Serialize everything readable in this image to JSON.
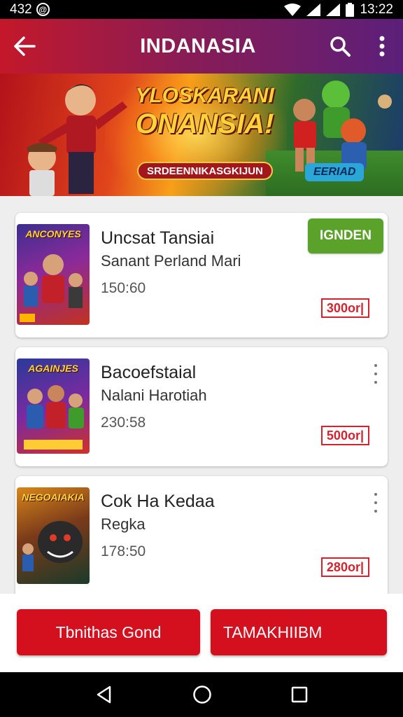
{
  "status_bar": {
    "time_left": "432",
    "clock": "13:22"
  },
  "app_bar": {
    "title": "INDANASIA"
  },
  "banner": {
    "headline_line1": "YLOSKARANI",
    "headline_line2": "ONANSIA!",
    "pill_text": "SRDEENNIKASGKIJUN",
    "tag_text": "EERIAD"
  },
  "items": [
    {
      "cover_title": "ANCONYES",
      "title": "Uncsat Tansiai",
      "subtitle": "Sanant Perland Mari",
      "time": "150:60",
      "price": "300or|",
      "action_label": "IGNDEN"
    },
    {
      "cover_title": "AGAINJES",
      "title": "Bacoefstaial",
      "subtitle": "Nalani Harotiah",
      "time": "230:58",
      "price": "500or|"
    },
    {
      "cover_title": "NEGOAIAKIA",
      "title": "Cok Ha Kedaa",
      "subtitle": "Regka",
      "time": "178:50",
      "price": "280or|"
    }
  ],
  "bottom_actions": {
    "primary_label": "Tbnithas Gond",
    "secondary_label": "TAMAKHIIBM"
  },
  "colors": {
    "brand_red": "#d4101f",
    "accent_green": "#5aa22a",
    "price_red": "#d4232f"
  },
  "icons": [
    "back-arrow-icon",
    "search-icon",
    "more-vert-icon",
    "wifi-icon",
    "signal-icon",
    "battery-icon",
    "nav-back-icon",
    "nav-home-icon",
    "nav-recents-icon"
  ]
}
